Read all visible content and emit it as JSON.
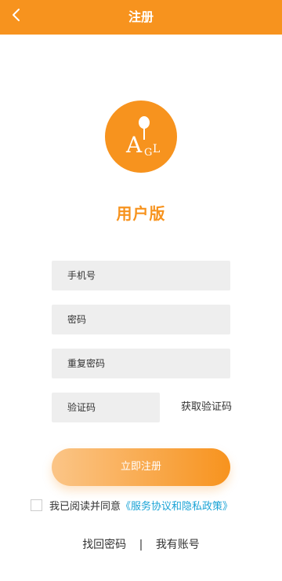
{
  "header": {
    "title": "注册",
    "back_icon": "chevron-left-icon",
    "background": "#f7931e"
  },
  "logo": {
    "letters": [
      "A",
      "G",
      "L"
    ],
    "color": "#f7931e"
  },
  "version_title": "用户版",
  "form": {
    "phone_placeholder": "手机号",
    "password_placeholder": "密码",
    "repeat_password_placeholder": "重复密码",
    "code_placeholder": "验证码",
    "get_code_label": "获取验证码"
  },
  "register_button": "立即注册",
  "agreement": {
    "checked": false,
    "text": "我已阅读并同意",
    "link": "《服务协议和隐私政策》",
    "link_color": "#1aa3d6"
  },
  "bottom": {
    "recover_password": "找回密码",
    "separator": "|",
    "have_account": "我有账号"
  }
}
